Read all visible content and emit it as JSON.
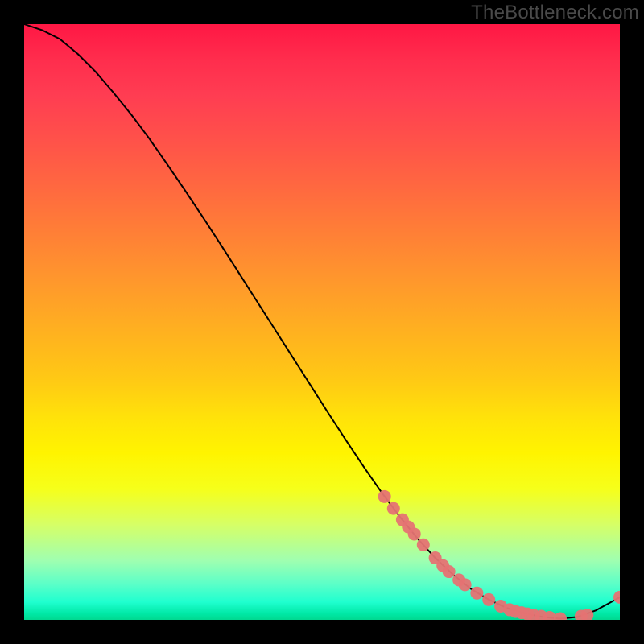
{
  "watermark": "TheBottleneck.com",
  "colors": {
    "gradient_top": "#ff1744",
    "gradient_mid": "#ffe20a",
    "gradient_bottom": "#00d88f",
    "curve": "#000000",
    "marker": "#e57373",
    "background": "#000000",
    "watermark_text": "#4a4a4a"
  },
  "chart_data": {
    "type": "line",
    "title": "",
    "xlabel": "",
    "ylabel": "",
    "xlim": [
      0,
      100
    ],
    "ylim": [
      0,
      100
    ],
    "series": [
      {
        "name": "bottleneck-curve",
        "x": [
          0,
          3,
          6,
          9,
          12,
          15,
          18,
          21,
          24,
          27,
          30,
          33,
          36,
          39,
          42,
          45,
          48,
          51,
          54,
          57,
          60,
          63,
          66,
          69,
          72,
          75,
          78,
          81,
          84,
          87,
          90,
          93,
          96,
          100
        ],
        "y": [
          100,
          99,
          97.5,
          95,
          92,
          88.5,
          84.8,
          80.8,
          76.5,
          72.1,
          67.6,
          63.0,
          58.3,
          53.6,
          48.9,
          44.2,
          39.5,
          34.8,
          30.2,
          25.7,
          21.4,
          17.4,
          13.7,
          10.4,
          7.6,
          5.2,
          3.4,
          2.0,
          1.1,
          0.5,
          0.2,
          0.5,
          1.6,
          3.8
        ]
      }
    ],
    "markers": {
      "name": "highlighted-points",
      "x": [
        60.5,
        62.0,
        63.5,
        64.5,
        65.5,
        67.0,
        69.0,
        70.3,
        71.3,
        73.0,
        74.0,
        76.0,
        78.0,
        80.0,
        81.5,
        82.5,
        83.5,
        84.5,
        85.5,
        86.8,
        88.2,
        90.0,
        93.5,
        94.5,
        100.0
      ],
      "y": [
        20.7,
        18.7,
        16.8,
        15.6,
        14.4,
        12.6,
        10.4,
        9.1,
        8.1,
        6.7,
        5.9,
        4.5,
        3.4,
        2.3,
        1.7,
        1.4,
        1.2,
        1.0,
        0.8,
        0.6,
        0.4,
        0.2,
        0.6,
        0.8,
        3.8
      ]
    }
  }
}
